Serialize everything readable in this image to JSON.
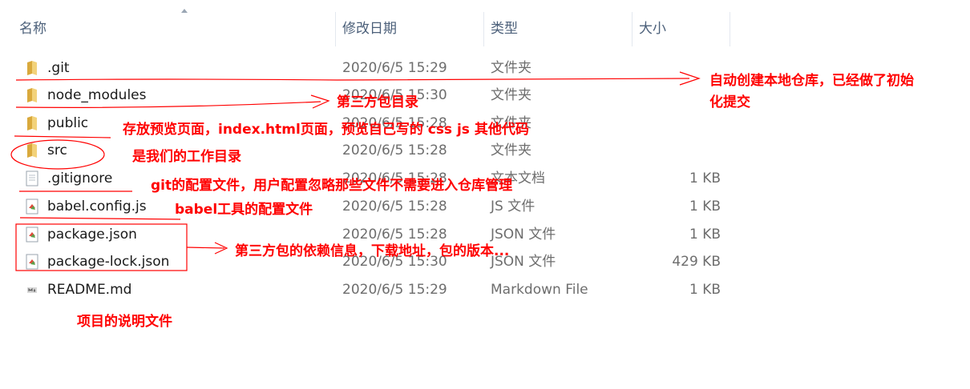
{
  "columns": {
    "name": "名称",
    "date": "修改日期",
    "type": "类型",
    "size": "大小"
  },
  "files": [
    {
      "name": ".git",
      "date": "2020/6/5 15:29",
      "type": "文件夹",
      "size": "",
      "icon": "folder-icon"
    },
    {
      "name": "node_modules",
      "date": "2020/6/5 15:30",
      "type": "文件夹",
      "size": "",
      "icon": "folder-icon"
    },
    {
      "name": "public",
      "date": "2020/6/5 15:28",
      "type": "文件夹",
      "size": "",
      "icon": "folder-icon"
    },
    {
      "name": "src",
      "date": "2020/6/5 15:28",
      "type": "文件夹",
      "size": "",
      "icon": "folder-icon"
    },
    {
      "name": ".gitignore",
      "date": "2020/6/5 15:28",
      "type": "文本文档",
      "size": "1 KB",
      "icon": "text-document-icon"
    },
    {
      "name": "babel.config.js",
      "date": "2020/6/5 15:28",
      "type": "JS 文件",
      "size": "1 KB",
      "icon": "js-file-icon"
    },
    {
      "name": "package.json",
      "date": "2020/6/5 15:28",
      "type": "JSON 文件",
      "size": "1 KB",
      "icon": "json-file-icon"
    },
    {
      "name": "package-lock.json",
      "date": "2020/6/5 15:30",
      "type": "JSON 文件",
      "size": "429 KB",
      "icon": "json-file-icon"
    },
    {
      "name": "README.md",
      "date": "2020/6/5 15:29",
      "type": "Markdown File",
      "size": "1 KB",
      "icon": "markdown-file-icon"
    }
  ],
  "annotations": {
    "git": "自动创建本地仓库，已经做了初始化提交",
    "node_modules": "第三方包目录",
    "public": "存放预览页面，index.html页面，预览自己写的 css  js  其他代码",
    "src": "是我们的工作目录",
    "gitignore": "git的配置文件，用户配置忽略那些文件不需要进入仓库管理",
    "babel": "babel工具的配置文件",
    "package": "第三方包的依赖信息，下载地址，包的版本...",
    "readme": "项目的说明文件"
  },
  "colors": {
    "annotation": "#ff0000",
    "folder": "#e8c25a",
    "header_text": "#4c607a"
  }
}
